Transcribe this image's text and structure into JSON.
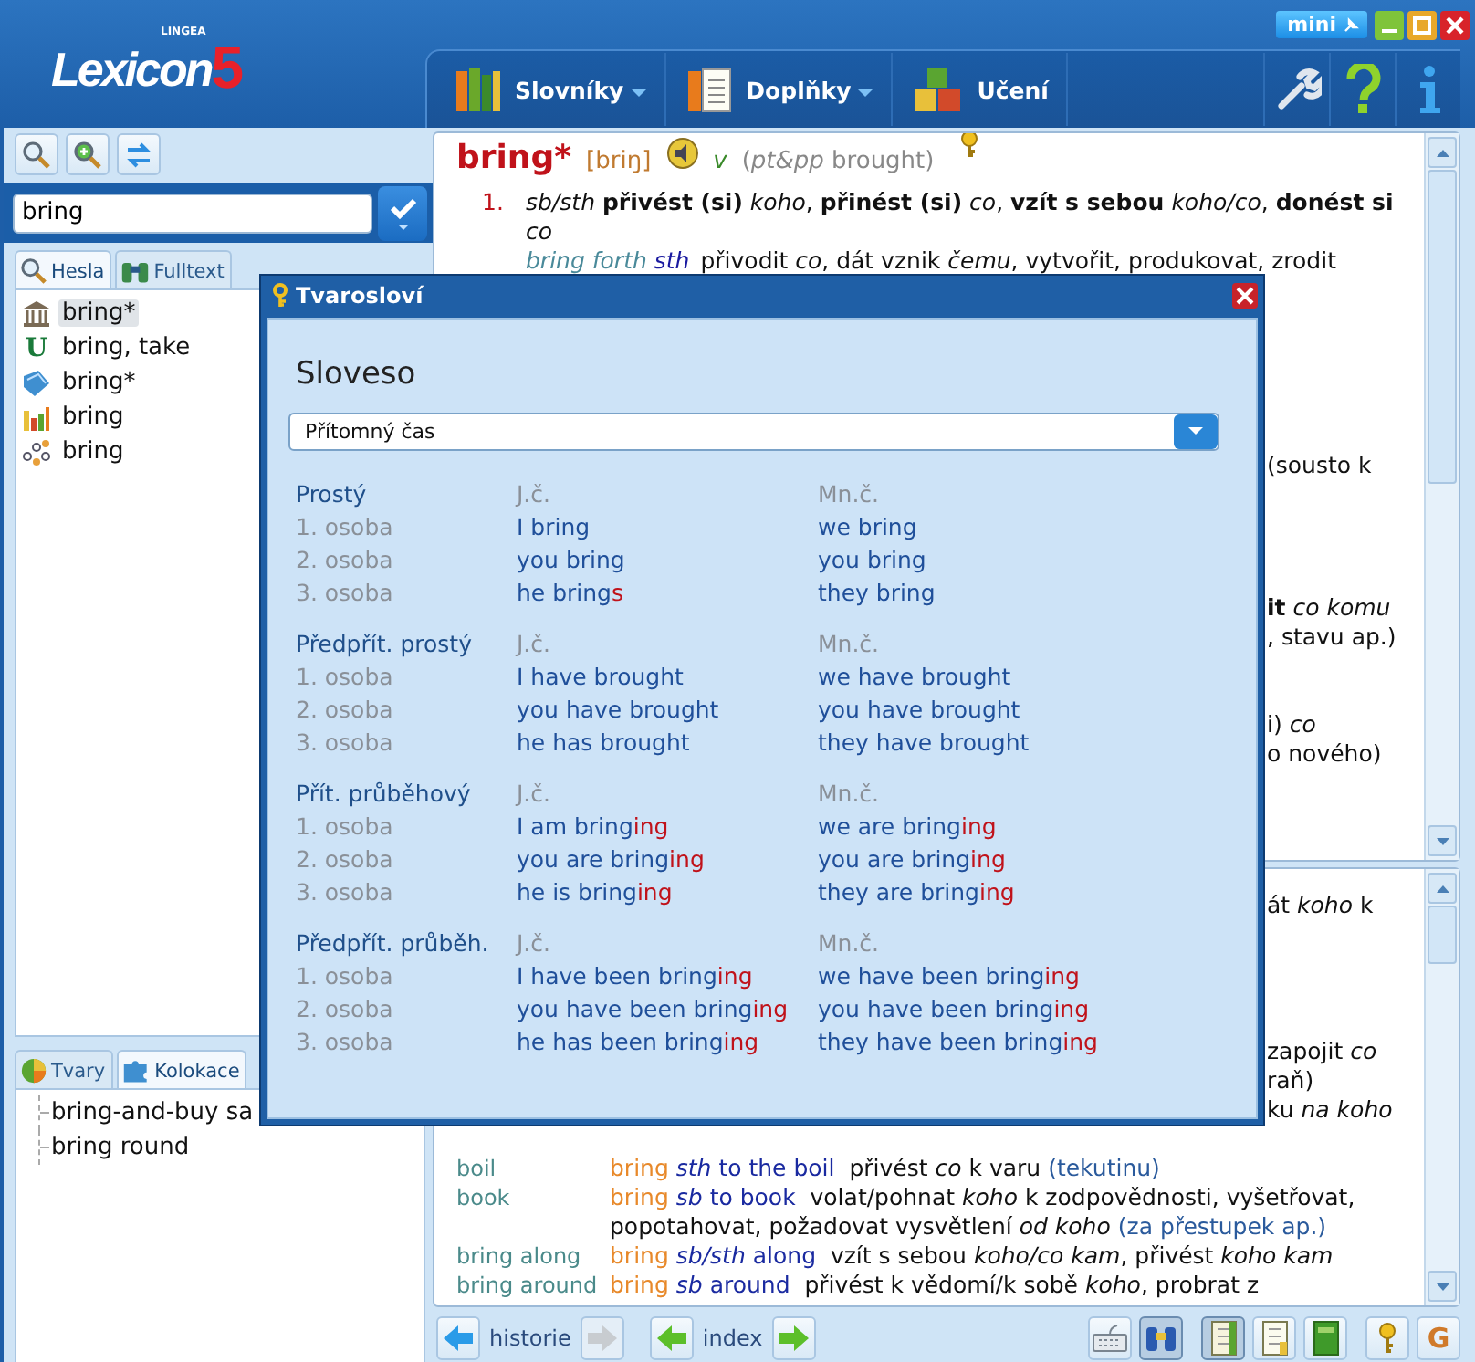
{
  "window": {
    "logo": {
      "brand": "LINGEA",
      "name": "Lexicon",
      "version": "5"
    },
    "mini_button": "mini"
  },
  "menu": [
    {
      "label": "Slovníky",
      "kind": "books",
      "dropdown": true
    },
    {
      "label": "Doplňky",
      "kind": "pages",
      "dropdown": true
    },
    {
      "label": "Učení",
      "kind": "blocks",
      "dropdown": false
    }
  ],
  "search": {
    "value": "bring"
  },
  "entry_tabs": [
    {
      "label": "Hesla",
      "kind": "search",
      "selected": true
    },
    {
      "label": "Fulltext",
      "kind": "binoculars",
      "selected": false
    }
  ],
  "entries": [
    {
      "text": "bring*",
      "kind": "building",
      "selected": true
    },
    {
      "text": "bring, take",
      "kind": "letter",
      "glyph": "U",
      "selected": false
    },
    {
      "text": "bring*",
      "kind": "book",
      "selected": false
    },
    {
      "text": "bring",
      "kind": "chart",
      "selected": false
    },
    {
      "text": "bring",
      "kind": "network",
      "selected": false
    }
  ],
  "lower_tabs": [
    {
      "label": "Tvary",
      "kind": "pie",
      "selected": false
    },
    {
      "label": "Kolokace",
      "kind": "puzzle",
      "selected": true
    }
  ],
  "collocations": [
    "bring-and-buy sa",
    "bring round"
  ],
  "entry": {
    "headword": "bring*",
    "pronunciation": "[briŋ]",
    "pos": "v",
    "grammar": "(*pt&pp* brought)",
    "senses": [
      {
        "number": "1.",
        "text": "*sb/sth* **přivést (si)** *koho*, **přinést (si)** *co*, **vzít s sebou** *koho/co*, **donést si** *co*",
        "examples": [
          {
            "phrase": "bring forth",
            "object": "sth",
            "translation": "přivodit *co*, dát vznik *čemu*, vytvořit, produkovat, zrodit"
          }
        ]
      }
    ]
  },
  "upper_fragments": [
    "(sousto k",
    "**it** *co komu*",
    ", stavu ap.)",
    "i) *co*",
    "o nového)"
  ],
  "lower_fragments": [
    "át *koho* k",
    "zapojit *co*",
    "raň)",
    "ku *na koho*"
  ],
  "phrases": [
    {
      "label": "boil",
      "head": "bring",
      "phrase": "*sth* to the boil",
      "translation": "přivést *co* k varu",
      "note": "(tekutinu)"
    },
    {
      "label": "book",
      "head": "bring",
      "phrase": "*sb* to book",
      "translation": "volat/pohnat *koho* k zodpovědnosti, vyšetřovat, popotahovat, požadovat vysvětlení *od koho*",
      "note": "(za přestupek ap.)"
    },
    {
      "label": "bring along",
      "head": "bring",
      "phrase": "*sb/sth* along",
      "translation": "vzít s sebou *koho/co kam*, přivést *koho kam*"
    },
    {
      "label": "bring around",
      "head": "bring",
      "phrase": "*sb* around",
      "translation": "přivést k vědomí/k sobě *koho*, probrat z"
    }
  ],
  "nav_groups": [
    {
      "kind": "history",
      "label": "historie",
      "back_disabled": false,
      "forward_disabled": true
    },
    {
      "kind": "index",
      "label": "index",
      "back_disabled": false,
      "forward_disabled": false
    }
  ],
  "tools": [
    {
      "kind": "keyboard",
      "selected": false
    },
    {
      "kind": "binoculars",
      "selected": true
    },
    {
      "kind": "notebook",
      "selected": true
    },
    {
      "kind": "page",
      "selected": false
    },
    {
      "kind": "greenbook",
      "selected": false
    },
    {
      "kind": "key",
      "selected": false
    },
    {
      "kind": "letter",
      "glyph": "G",
      "selected": false
    }
  ],
  "dialog": {
    "title": "Tvarosloví",
    "heading": "Sloveso",
    "tense": "Přítomný čas",
    "groups": [
      {
        "name": "Prostý",
        "singular_label": "J.č.",
        "plural_label": "Mn.č.",
        "rows": [
          {
            "person": "1. osoba",
            "singular": {
              "stem": "I bring"
            },
            "plural": {
              "stem": "we bring"
            }
          },
          {
            "person": "2. osoba",
            "singular": {
              "stem": "you bring"
            },
            "plural": {
              "stem": "you bring"
            }
          },
          {
            "person": "3. osoba",
            "singular": {
              "stem": "he bring",
              "ending": "s"
            },
            "plural": {
              "stem": "they bring"
            }
          }
        ]
      },
      {
        "name": "Předpřít. prostý",
        "singular_label": "J.č.",
        "plural_label": "Mn.č.",
        "rows": [
          {
            "person": "1. osoba",
            "singular": {
              "stem": "I have brought"
            },
            "plural": {
              "stem": "we have brought"
            }
          },
          {
            "person": "2. osoba",
            "singular": {
              "stem": "you have brought"
            },
            "plural": {
              "stem": "you have brought"
            }
          },
          {
            "person": "3. osoba",
            "singular": {
              "stem": "he has brought"
            },
            "plural": {
              "stem": "they have brought"
            }
          }
        ]
      },
      {
        "name": "Přít. průběhový",
        "singular_label": "J.č.",
        "plural_label": "Mn.č.",
        "rows": [
          {
            "person": "1. osoba",
            "singular": {
              "stem": "I am bring",
              "ending": "ing"
            },
            "plural": {
              "stem": "we are bring",
              "ending": "ing"
            }
          },
          {
            "person": "2. osoba",
            "singular": {
              "stem": "you are bring",
              "ending": "ing"
            },
            "plural": {
              "stem": "you are bring",
              "ending": "ing"
            }
          },
          {
            "person": "3. osoba",
            "singular": {
              "stem": "he is bring",
              "ending": "ing"
            },
            "plural": {
              "stem": "they are bring",
              "ending": "ing"
            }
          }
        ]
      },
      {
        "name": "Předpřít. průběh.",
        "singular_label": "J.č.",
        "plural_label": "Mn.č.",
        "rows": [
          {
            "person": "1. osoba",
            "singular": {
              "stem": "I have been bring",
              "ending": "ing"
            },
            "plural": {
              "stem": "we have been bring",
              "ending": "ing"
            }
          },
          {
            "person": "2. osoba",
            "singular": {
              "stem": "you have been bring",
              "ending": "ing"
            },
            "plural": {
              "stem": "you have been bring",
              "ending": "ing"
            }
          },
          {
            "person": "3. osoba",
            "singular": {
              "stem": "he has been bring",
              "ending": "ing"
            },
            "plural": {
              "stem": "they have been bring",
              "ending": "ing"
            }
          }
        ]
      }
    ]
  }
}
